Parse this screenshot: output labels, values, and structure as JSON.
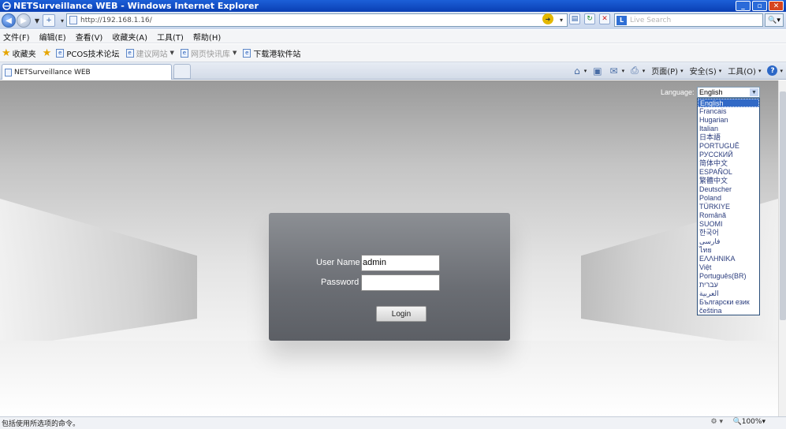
{
  "window": {
    "title": "NETSurveillance WEB - Windows Internet Explorer"
  },
  "address": {
    "url": "http://192.168.1.16/",
    "search_placeholder": "Live Search"
  },
  "menu": [
    "文件(F)",
    "编辑(E)",
    "查看(V)",
    "收藏夹(A)",
    "工具(T)",
    "帮助(H)"
  ],
  "favorites": {
    "label": "收藏夹",
    "items": [
      {
        "label": "PCOS技术论坛",
        "dim": false
      },
      {
        "label": "建议网站",
        "dim": true,
        "caret": true
      },
      {
        "label": "网页快讯库",
        "dim": true,
        "caret": true
      },
      {
        "label": "下载港软件站",
        "dim": false
      }
    ]
  },
  "tab": {
    "title": "NETSurveillance WEB"
  },
  "commandbar": {
    "page": "页面(P)",
    "safety": "安全(S)",
    "tools": "工具(O)"
  },
  "login": {
    "language_label": "Language:",
    "language_selected": "English",
    "languages": [
      "English",
      "Francais",
      "Hugarian",
      "Italian",
      "日本語",
      "PORTUGUÊ",
      "РУССКИЙ",
      "简体中文",
      "ESPAÑOL",
      "繁體中文",
      "Deutscher",
      "Poland",
      "TÜRKIYE",
      "Română",
      "SUOMI",
      "한국어",
      "فارسی",
      "ไทย",
      "ΕΛΛΗΝΙΚΑ",
      "Việt",
      "Português(BR)",
      "עברית",
      "العربية",
      "Български език",
      "čeština"
    ],
    "username_label": "User Name",
    "username_value": "admin",
    "password_label": "Password",
    "password_value": "",
    "login_button": "Login"
  },
  "status": {
    "text": "包括使用所选项的命令。",
    "zoom": "100%"
  }
}
